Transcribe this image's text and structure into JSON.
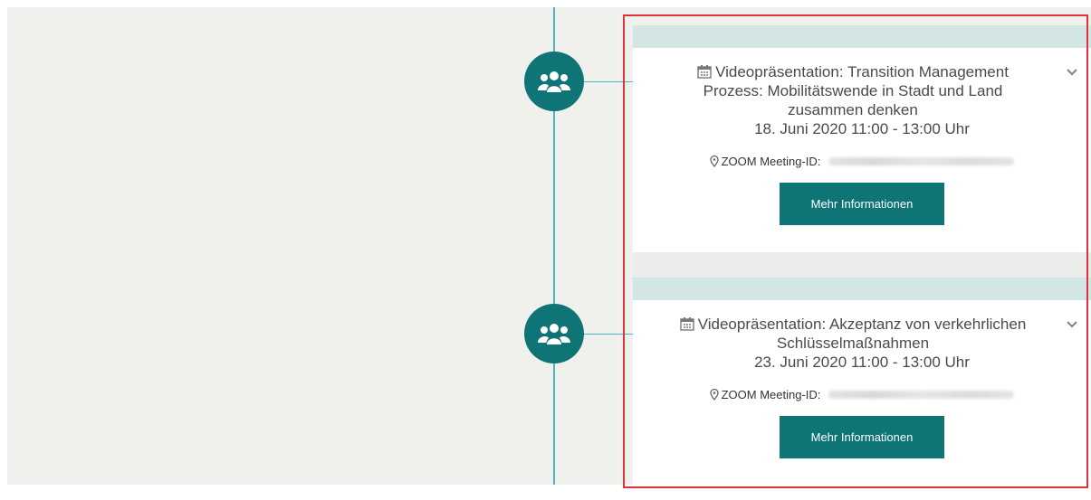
{
  "events": [
    {
      "title": "Videopräsentation: Transition Management Prozess: Mobilitätswende in Stadt und Land zusammen denken",
      "date": "18. Juni 2020 11:00 - 13:00 Uhr",
      "meeting_label": "ZOOM Meeting-ID:",
      "button_label": "Mehr Informationen"
    },
    {
      "title": "Videopräsentation: Akzeptanz von verkehrlichen Schlüsselmaßnahmen",
      "date": "23. Juni 2020 11:00 - 13:00 Uhr",
      "meeting_label": "ZOOM Meeting-ID:",
      "button_label": "Mehr Informationen"
    }
  ],
  "icons": {
    "timeline_node": "people-group-icon",
    "calendar": "calendar-icon",
    "location": "map-pin-icon",
    "expand": "chevron-down-icon"
  },
  "colors": {
    "accent": "#0e7476",
    "timeline": "#4cb4c4",
    "card_header": "#d3e5e5",
    "highlight": "#e0303a",
    "background": "#f0f0ed"
  }
}
